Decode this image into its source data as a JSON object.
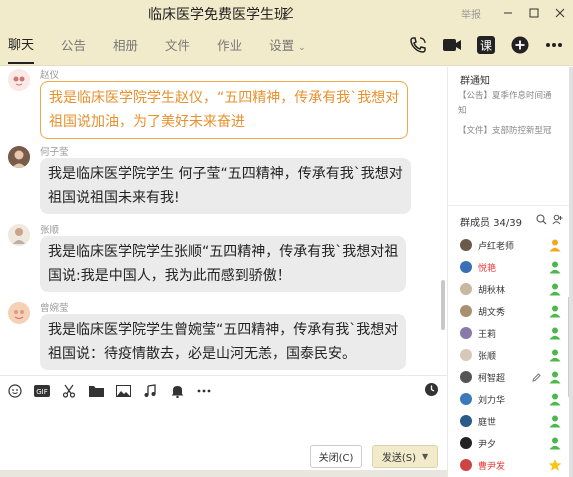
{
  "window": {
    "title": "临床医学免费医学生班",
    "report": "举报"
  },
  "tabs": [
    {
      "label": "聊天",
      "active": true
    },
    {
      "label": "公告"
    },
    {
      "label": "相册"
    },
    {
      "label": "文件"
    },
    {
      "label": "作业"
    },
    {
      "label": "设置"
    }
  ],
  "toolbar_icons": [
    "phone-icon",
    "video-icon",
    "class-icon",
    "add-icon",
    "more-icon"
  ],
  "toolbar": {
    "class_label": "课"
  },
  "messages": [
    {
      "sender": "赵仪",
      "lines": [
        "我是临床医学院学生赵仪，“五四精神，传承有我`我想对",
        "祖国说加油，为了美好未来奋进"
      ],
      "highlight": true
    },
    {
      "sender": "何子莹",
      "lines": [
        "我是临床医学院学生 何子莹“五四精神，传承有我`我想对",
        "祖国说祖国未来有我!"
      ]
    },
    {
      "sender": "张顺",
      "lines": [
        "我是临床医学院学生张顺“五四精神，传承有我`我想对祖",
        "国说:我是中国人，我为此而感到骄傲！"
      ]
    },
    {
      "sender": "曾婉莹",
      "lines": [
        "我是临床医学院学生曾婉莹“五四精神，传承有我`我想对",
        "祖国说：待疫情散去，必是山河无恙，国泰民安。"
      ]
    }
  ],
  "input_tools": [
    "emoji-icon",
    "gif-icon",
    "scissors-icon",
    "folder-icon",
    "image-icon",
    "music-icon",
    "bell-icon",
    "more-dots-icon"
  ],
  "buttons": {
    "close": "关闭(C)",
    "send": "发送(S)"
  },
  "notice": {
    "title": "群通知",
    "lines": [
      "【公告】夏季作息时间通",
      "知",
      "【文件】支部防控新型冠"
    ]
  },
  "members": {
    "title": "群成员 34/39",
    "list": [
      {
        "name": "卢红老师",
        "color": "#333",
        "role": "owner"
      },
      {
        "name": "悦艳",
        "color": "#e33",
        "role": "admin"
      },
      {
        "name": "胡秋林",
        "color": "#333",
        "role": "admin"
      },
      {
        "name": "胡文秀",
        "color": "#333",
        "role": "admin"
      },
      {
        "name": "王莉",
        "color": "#333",
        "role": "admin"
      },
      {
        "name": "张顺",
        "color": "#333",
        "role": "admin"
      },
      {
        "name": "柯智超",
        "color": "#333",
        "role": "admin"
      },
      {
        "name": "刘力华",
        "color": "#333",
        "role": "admin"
      },
      {
        "name": "庭世",
        "color": "#333",
        "role": "admin"
      },
      {
        "name": "尹夕",
        "color": "#333",
        "role": "admin"
      },
      {
        "name": "曹尹发",
        "color": "#e33",
        "role": "star"
      }
    ]
  },
  "colors": {
    "titlebar": "#f2ebcb",
    "highlight_border": "#f0a848",
    "highlight_text": "#e8902c",
    "bubble": "#ebebeb"
  }
}
